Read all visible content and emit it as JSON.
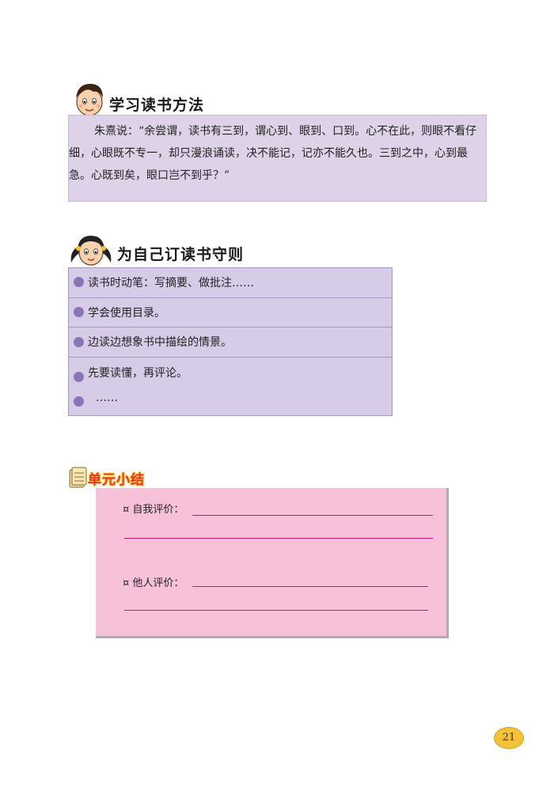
{
  "section1": {
    "title": "学习读书方法",
    "quote": "朱熹说：“余尝谓，读书有三到，谓心到、眼到、口到。心不在此，则眼不看仔细，心眼既不专一，却只漫浪诵读，决不能记，记亦不能久也。三到之中，心到最急。心既到矣，眼口岂不到乎？”"
  },
  "section2": {
    "title": "为自己订读书守则",
    "rules": [
      "读书时动笔：写摘要、做批注……",
      "学会使用目录。",
      "边读边想象书中描绘的情景。",
      "先要读懂，再评论。",
      "……"
    ]
  },
  "summary": {
    "badge_label": "单元小结",
    "self_eval_label": "¤ 自我评价：",
    "others_eval_label": "¤ 他人评价："
  },
  "page_number": "21",
  "colors": {
    "quote_bg": "#ddd2e8",
    "rules_bg": "#d7cce8",
    "bullet": "#8a74b8",
    "summary_bg": "#f7c1da",
    "line": "#c0177b",
    "page_badge": "#f3c23a"
  }
}
